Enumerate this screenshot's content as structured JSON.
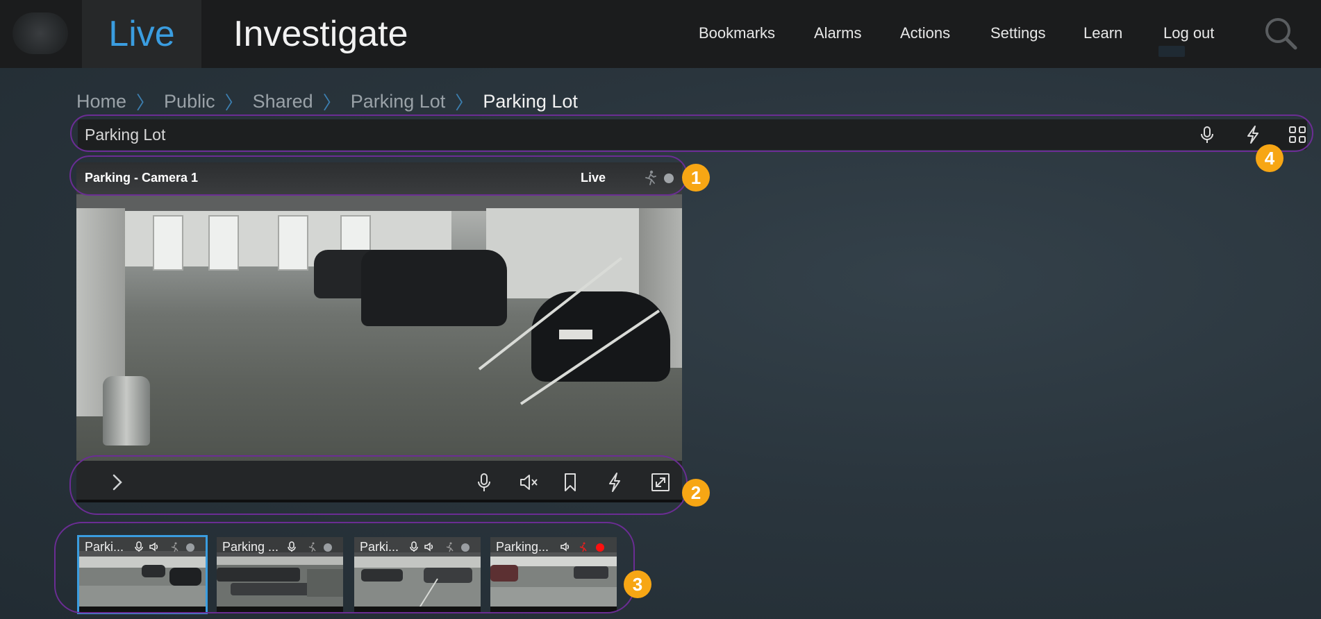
{
  "topbar": {
    "live_tab": "Live",
    "investigate_tab": "Investigate",
    "nav": [
      "Bookmarks",
      "Alarms",
      "Actions",
      "Settings",
      "Learn",
      "Log out"
    ],
    "accent_color": "#3a9de0"
  },
  "breadcrumb": {
    "items": [
      "Home",
      "Public",
      "Shared",
      "Parking Lot",
      "Parking Lot"
    ]
  },
  "view": {
    "title": "Parking Lot",
    "icons": [
      "microphone-icon",
      "lightning-icon",
      "grid-icon"
    ]
  },
  "camera": {
    "title": "Parking - Camera 1",
    "status": "Live",
    "controls": [
      "expand-chevron-icon",
      "microphone-icon",
      "speaker-muted-icon",
      "bookmark-icon",
      "lightning-icon",
      "fullscreen-icon"
    ]
  },
  "thumbnails": [
    {
      "title": "Parki...",
      "selected": true
    },
    {
      "title": "Parking ..."
    },
    {
      "title": "Parki..."
    },
    {
      "title": "Parking..."
    }
  ],
  "callouts": [
    "1",
    "2",
    "3",
    "4"
  ],
  "callout_color": "#f7a614",
  "highlight_color": "#6b2d94"
}
